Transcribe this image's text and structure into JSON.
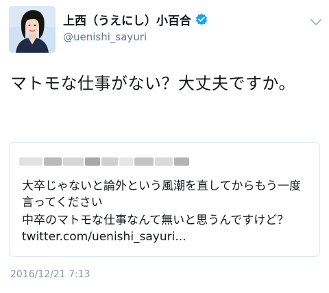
{
  "author": {
    "display_name": "上西（うえにし）小百合",
    "handle": "@uenishi_sayuri",
    "verified": true,
    "avatar_icon": "profile-photo",
    "verified_icon": "verified-badge-icon"
  },
  "tweet": {
    "text": "マトモな仕事がない？大丈夫ですか。",
    "timestamp": "2016/12/21 7:13"
  },
  "quoted_tweet": {
    "header_obscured": true,
    "line1": "大卒じゃないと論外という風潮を直してからもう一度言ってください",
    "line2": "中卒のマトモな仕事なんて無いと思うんですけど？ twitter.com/uenishi_sayuri..."
  },
  "colors": {
    "verified_blue": "#1da1f2",
    "secondary_text": "#657786",
    "timestamp_text": "#8899a6",
    "border": "#e1e8ed"
  }
}
